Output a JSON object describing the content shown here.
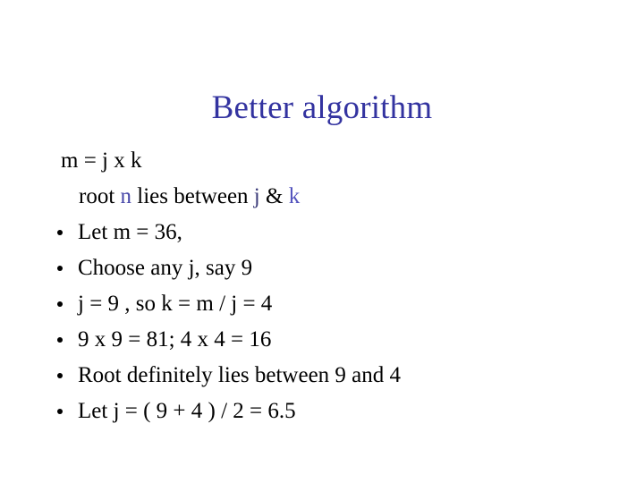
{
  "slide": {
    "title": "Better algorithm",
    "title_color": "#3333A0",
    "background_color": "#ffffff",
    "text_color": "#000000",
    "bullet_glyph": "•",
    "lines": [
      {
        "id": "definition-product",
        "bulleted": false,
        "indent": "level-1",
        "text": "m = j x k"
      },
      {
        "id": "definition-root-range",
        "bulleted": false,
        "indent": "level-2",
        "text": "root n lies between j & k",
        "parts": {
          "before_n": "root ",
          "n": "n",
          "middle": " lies between ",
          "j": "j",
          "amp": " & ",
          "k": "k"
        }
      },
      {
        "id": "step-let-m",
        "bulleted": true,
        "text": "Let  m = 36,"
      },
      {
        "id": "step-choose-j",
        "bulleted": true,
        "text": "Choose any   j, say  9"
      },
      {
        "id": "step-compute-k",
        "bulleted": true,
        "text": "j = 9 ,  so  k = m / j    = 4"
      },
      {
        "id": "step-squares",
        "bulleted": true,
        "text": "9 x 9 = 81;       4 x 4  = 16"
      },
      {
        "id": "step-root-between",
        "bulleted": true,
        "text": "Root  definitely lies  between  9  and  4"
      },
      {
        "id": "step-new-j",
        "bulleted": true,
        "text": "Let  j = ( 9 + 4 ) / 2    = 6.5"
      }
    ],
    "values": {
      "m": "36",
      "j_initial": "9",
      "k_initial": "4",
      "j_squared": "81",
      "k_squared": "16",
      "j_next": "6.5"
    },
    "colors": {
      "title_blue": "#3333A0",
      "token_n_blue": "#4646A8",
      "token_j_navy": "#3A3A78",
      "token_k_periwinkle": "#5252BD",
      "body_black": "#000000"
    }
  }
}
